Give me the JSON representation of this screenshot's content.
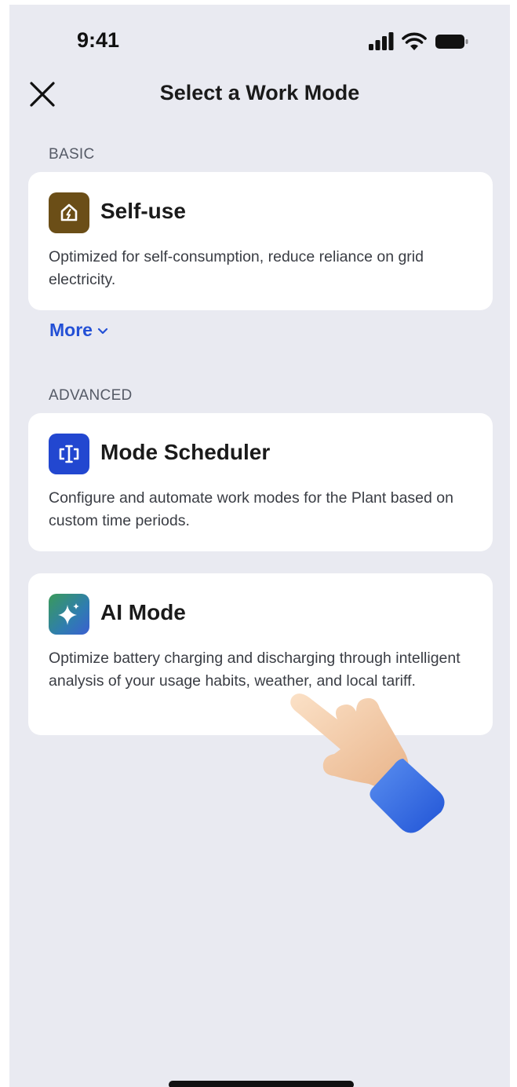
{
  "status_bar": {
    "time": "9:41"
  },
  "header": {
    "title": "Select a Work Mode"
  },
  "basic_section": {
    "label": "BASIC",
    "cards": [
      {
        "title": "Self-use",
        "description": "Optimized for self-consumption, reduce reliance on grid electricity.",
        "icon": "home-icon",
        "icon_color": "#6b4e17"
      }
    ],
    "more_label": "More"
  },
  "advanced_section": {
    "label": "ADVANCED",
    "cards": [
      {
        "title": "Mode Scheduler",
        "description": "Configure and automate work modes for the Plant based on custom time periods.",
        "icon": "scheduler-icon",
        "icon_color": "#2247d0"
      },
      {
        "title": "AI Mode",
        "description": "Optimize battery charging and discharging through intelligent analysis of your usage habits, weather, and local tariff.",
        "icon": "sparkle-icon",
        "icon_color": "#2f9a6a"
      }
    ]
  },
  "colors": {
    "accent": "#2350d6",
    "background": "#e9eaf1",
    "card": "#ffffff"
  }
}
